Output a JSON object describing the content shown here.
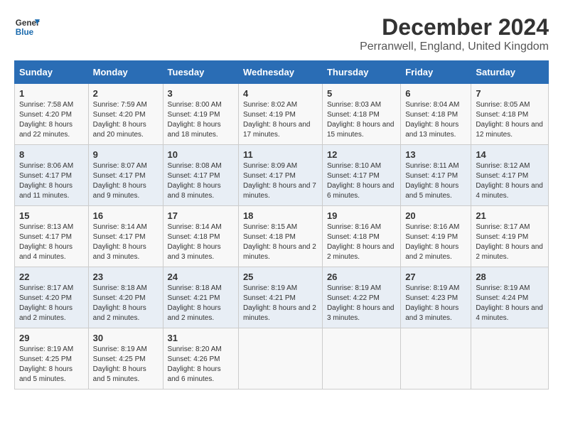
{
  "logo": {
    "line1": "General",
    "line2": "Blue"
  },
  "title": "December 2024",
  "subtitle": "Perranwell, England, United Kingdom",
  "days_of_week": [
    "Sunday",
    "Monday",
    "Tuesday",
    "Wednesday",
    "Thursday",
    "Friday",
    "Saturday"
  ],
  "weeks": [
    [
      {
        "day": "1",
        "sunrise": "Sunrise: 7:58 AM",
        "sunset": "Sunset: 4:20 PM",
        "daylight": "Daylight: 8 hours and 22 minutes."
      },
      {
        "day": "2",
        "sunrise": "Sunrise: 7:59 AM",
        "sunset": "Sunset: 4:20 PM",
        "daylight": "Daylight: 8 hours and 20 minutes."
      },
      {
        "day": "3",
        "sunrise": "Sunrise: 8:00 AM",
        "sunset": "Sunset: 4:19 PM",
        "daylight": "Daylight: 8 hours and 18 minutes."
      },
      {
        "day": "4",
        "sunrise": "Sunrise: 8:02 AM",
        "sunset": "Sunset: 4:19 PM",
        "daylight": "Daylight: 8 hours and 17 minutes."
      },
      {
        "day": "5",
        "sunrise": "Sunrise: 8:03 AM",
        "sunset": "Sunset: 4:18 PM",
        "daylight": "Daylight: 8 hours and 15 minutes."
      },
      {
        "day": "6",
        "sunrise": "Sunrise: 8:04 AM",
        "sunset": "Sunset: 4:18 PM",
        "daylight": "Daylight: 8 hours and 13 minutes."
      },
      {
        "day": "7",
        "sunrise": "Sunrise: 8:05 AM",
        "sunset": "Sunset: 4:18 PM",
        "daylight": "Daylight: 8 hours and 12 minutes."
      }
    ],
    [
      {
        "day": "8",
        "sunrise": "Sunrise: 8:06 AM",
        "sunset": "Sunset: 4:17 PM",
        "daylight": "Daylight: 8 hours and 11 minutes."
      },
      {
        "day": "9",
        "sunrise": "Sunrise: 8:07 AM",
        "sunset": "Sunset: 4:17 PM",
        "daylight": "Daylight: 8 hours and 9 minutes."
      },
      {
        "day": "10",
        "sunrise": "Sunrise: 8:08 AM",
        "sunset": "Sunset: 4:17 PM",
        "daylight": "Daylight: 8 hours and 8 minutes."
      },
      {
        "day": "11",
        "sunrise": "Sunrise: 8:09 AM",
        "sunset": "Sunset: 4:17 PM",
        "daylight": "Daylight: 8 hours and 7 minutes."
      },
      {
        "day": "12",
        "sunrise": "Sunrise: 8:10 AM",
        "sunset": "Sunset: 4:17 PM",
        "daylight": "Daylight: 8 hours and 6 minutes."
      },
      {
        "day": "13",
        "sunrise": "Sunrise: 8:11 AM",
        "sunset": "Sunset: 4:17 PM",
        "daylight": "Daylight: 8 hours and 5 minutes."
      },
      {
        "day": "14",
        "sunrise": "Sunrise: 8:12 AM",
        "sunset": "Sunset: 4:17 PM",
        "daylight": "Daylight: 8 hours and 4 minutes."
      }
    ],
    [
      {
        "day": "15",
        "sunrise": "Sunrise: 8:13 AM",
        "sunset": "Sunset: 4:17 PM",
        "daylight": "Daylight: 8 hours and 4 minutes."
      },
      {
        "day": "16",
        "sunrise": "Sunrise: 8:14 AM",
        "sunset": "Sunset: 4:17 PM",
        "daylight": "Daylight: 8 hours and 3 minutes."
      },
      {
        "day": "17",
        "sunrise": "Sunrise: 8:14 AM",
        "sunset": "Sunset: 4:18 PM",
        "daylight": "Daylight: 8 hours and 3 minutes."
      },
      {
        "day": "18",
        "sunrise": "Sunrise: 8:15 AM",
        "sunset": "Sunset: 4:18 PM",
        "daylight": "Daylight: 8 hours and 2 minutes."
      },
      {
        "day": "19",
        "sunrise": "Sunrise: 8:16 AM",
        "sunset": "Sunset: 4:18 PM",
        "daylight": "Daylight: 8 hours and 2 minutes."
      },
      {
        "day": "20",
        "sunrise": "Sunrise: 8:16 AM",
        "sunset": "Sunset: 4:19 PM",
        "daylight": "Daylight: 8 hours and 2 minutes."
      },
      {
        "day": "21",
        "sunrise": "Sunrise: 8:17 AM",
        "sunset": "Sunset: 4:19 PM",
        "daylight": "Daylight: 8 hours and 2 minutes."
      }
    ],
    [
      {
        "day": "22",
        "sunrise": "Sunrise: 8:17 AM",
        "sunset": "Sunset: 4:20 PM",
        "daylight": "Daylight: 8 hours and 2 minutes."
      },
      {
        "day": "23",
        "sunrise": "Sunrise: 8:18 AM",
        "sunset": "Sunset: 4:20 PM",
        "daylight": "Daylight: 8 hours and 2 minutes."
      },
      {
        "day": "24",
        "sunrise": "Sunrise: 8:18 AM",
        "sunset": "Sunset: 4:21 PM",
        "daylight": "Daylight: 8 hours and 2 minutes."
      },
      {
        "day": "25",
        "sunrise": "Sunrise: 8:19 AM",
        "sunset": "Sunset: 4:21 PM",
        "daylight": "Daylight: 8 hours and 2 minutes."
      },
      {
        "day": "26",
        "sunrise": "Sunrise: 8:19 AM",
        "sunset": "Sunset: 4:22 PM",
        "daylight": "Daylight: 8 hours and 3 minutes."
      },
      {
        "day": "27",
        "sunrise": "Sunrise: 8:19 AM",
        "sunset": "Sunset: 4:23 PM",
        "daylight": "Daylight: 8 hours and 3 minutes."
      },
      {
        "day": "28",
        "sunrise": "Sunrise: 8:19 AM",
        "sunset": "Sunset: 4:24 PM",
        "daylight": "Daylight: 8 hours and 4 minutes."
      }
    ],
    [
      {
        "day": "29",
        "sunrise": "Sunrise: 8:19 AM",
        "sunset": "Sunset: 4:25 PM",
        "daylight": "Daylight: 8 hours and 5 minutes."
      },
      {
        "day": "30",
        "sunrise": "Sunrise: 8:19 AM",
        "sunset": "Sunset: 4:25 PM",
        "daylight": "Daylight: 8 hours and 5 minutes."
      },
      {
        "day": "31",
        "sunrise": "Sunrise: 8:20 AM",
        "sunset": "Sunset: 4:26 PM",
        "daylight": "Daylight: 8 hours and 6 minutes."
      },
      null,
      null,
      null,
      null
    ]
  ]
}
